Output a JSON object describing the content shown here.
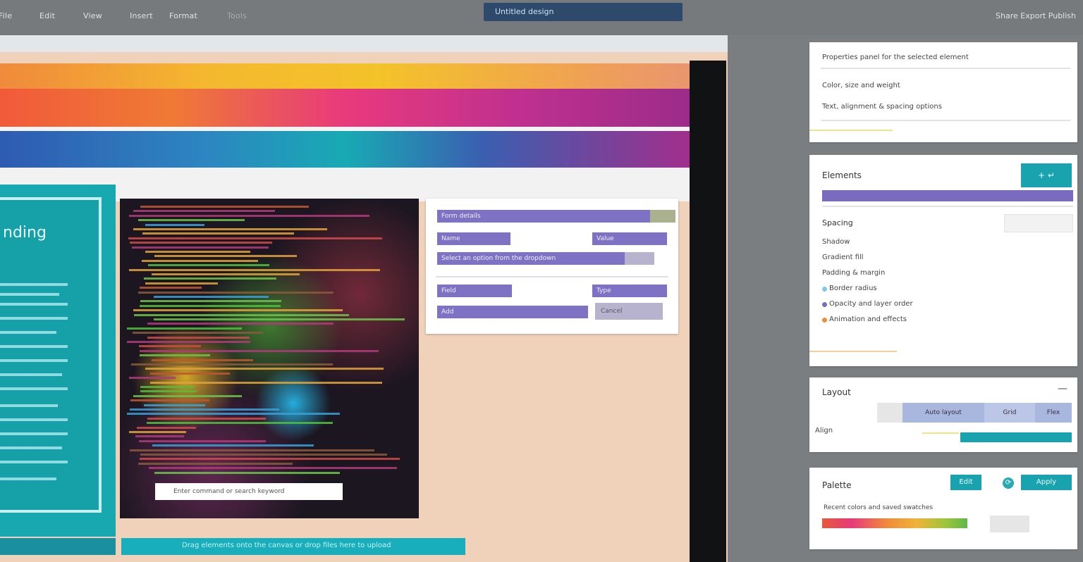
{
  "topbar": {
    "menu": [
      "File",
      "Edit",
      "View",
      "Insert",
      "Format",
      "Tools"
    ],
    "title": "Untitled design",
    "right_text": "Share  Export  Publish"
  },
  "canvas": {
    "left_panel_title": "nding",
    "code_input_text": "Enter command or search keyword",
    "bottom_strip_text": "Drag elements onto the canvas or drop files here to upload"
  },
  "form_card": {
    "header": "Form details",
    "row1_left": "Name",
    "row1_right": "Value",
    "row2": "Select an option from the dropdown",
    "row3_left": "Field",
    "row3_right": "Type",
    "row4_left": "Add",
    "row4_right": "Cancel"
  },
  "sidebar": {
    "card1": {
      "line1": "Properties panel for the selected element",
      "line2": "Color, size and weight",
      "line3": "Text, alignment & spacing options"
    },
    "card2": {
      "title": "Elements",
      "button": "+ ↵",
      "subtitle": "Spacing",
      "items": [
        "Shadow",
        "Gradient fill",
        "Padding & margin",
        "Border radius",
        "Opacity and layer order",
        "Animation and effects"
      ]
    },
    "card3": {
      "title": "Layout",
      "tabs": [
        "",
        "Auto layout",
        "Grid",
        "Flex"
      ],
      "label": "Align"
    },
    "card4": {
      "title": "Palette",
      "btn1": "Edit",
      "btn2": "Apply",
      "caption": "Recent colors and saved swatches"
    }
  },
  "colors": {
    "teal": "#19a3ae",
    "violet": "#7a6bc0",
    "title_blue": "#2d4a6d"
  }
}
